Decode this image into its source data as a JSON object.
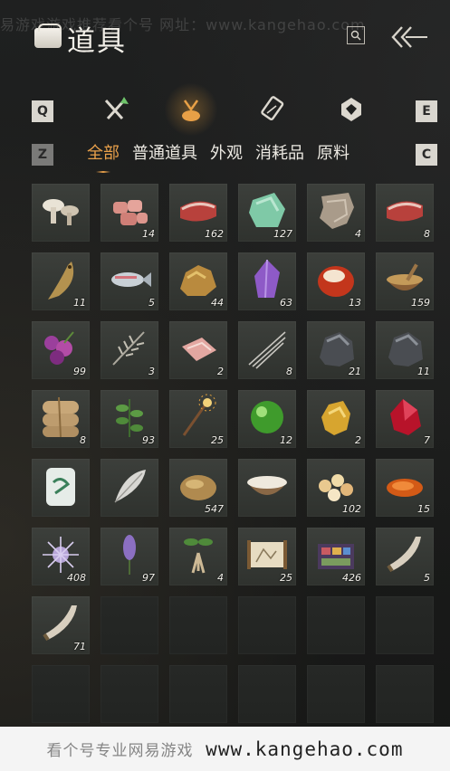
{
  "watermark_top": "易游戏游戏推荐看个号   网址：www.kangehao.com",
  "header": {
    "title": "道具",
    "search_icon": "search-icon",
    "back_icon": "back-arrow-icon"
  },
  "key_hints": {
    "prev_tab": "Q",
    "next_tab": "E",
    "prev_filter": "Z",
    "next_filter": "C"
  },
  "category_tabs": [
    {
      "name": "tools-tab",
      "icon": "crossed-tools-icon",
      "active": false
    },
    {
      "name": "items-tab",
      "icon": "pouch-icon",
      "active": true
    },
    {
      "name": "scrolls-tab",
      "icon": "scroll-icon",
      "active": false
    },
    {
      "name": "gems-tab",
      "icon": "gem-badge-icon",
      "active": false
    }
  ],
  "filters": [
    {
      "label": "全部",
      "active": true
    },
    {
      "label": "普通道具",
      "active": false
    },
    {
      "label": "外观",
      "active": false
    },
    {
      "label": "消耗品",
      "active": false
    },
    {
      "label": "原料",
      "active": false
    }
  ],
  "items": [
    {
      "icon": "mushrooms-icon",
      "qty": ""
    },
    {
      "icon": "meat-chunks-icon",
      "qty": "14"
    },
    {
      "icon": "steak-icon",
      "qty": "162"
    },
    {
      "icon": "jade-stone-icon",
      "qty": "127"
    },
    {
      "icon": "animal-hide-icon",
      "qty": "4"
    },
    {
      "icon": "steak-icon",
      "qty": "8"
    },
    {
      "icon": "fish-dried-icon",
      "qty": "11"
    },
    {
      "icon": "fish-icon",
      "qty": "5"
    },
    {
      "icon": "gold-ore-icon",
      "qty": "44"
    },
    {
      "icon": "amethyst-icon",
      "qty": "63"
    },
    {
      "icon": "red-agate-icon",
      "qty": "13"
    },
    {
      "icon": "grain-bowl-icon",
      "qty": "159"
    },
    {
      "icon": "purple-flower-icon",
      "qty": "99"
    },
    {
      "icon": "wheat-icon",
      "qty": "3"
    },
    {
      "icon": "raw-meat-slice-icon",
      "qty": "2"
    },
    {
      "icon": "quills-icon",
      "qty": "8"
    },
    {
      "icon": "iron-ore-icon",
      "qty": "21"
    },
    {
      "icon": "iron-ore-icon",
      "qty": "11"
    },
    {
      "icon": "grain-sacks-icon",
      "qty": "8"
    },
    {
      "icon": "herb-plant-icon",
      "qty": "93"
    },
    {
      "icon": "firework-stick-icon",
      "qty": "25"
    },
    {
      "icon": "green-orb-icon",
      "qty": "12"
    },
    {
      "icon": "gold-nugget-icon",
      "qty": "2"
    },
    {
      "icon": "red-crystal-icon",
      "qty": "7"
    },
    {
      "icon": "porcelain-vase-icon",
      "qty": ""
    },
    {
      "icon": "feather-icon",
      "qty": ""
    },
    {
      "icon": "seed-pod-icon",
      "qty": "547"
    },
    {
      "icon": "milk-bowl-icon",
      "qty": ""
    },
    {
      "icon": "pastries-icon",
      "qty": "102"
    },
    {
      "icon": "orange-paste-icon",
      "qty": "15"
    },
    {
      "icon": "spiky-flower-icon",
      "qty": "408"
    },
    {
      "icon": "lavender-icon",
      "qty": "97"
    },
    {
      "icon": "ginseng-icon",
      "qty": "4"
    },
    {
      "icon": "painting-scroll-icon",
      "qty": "25"
    },
    {
      "icon": "paint-box-icon",
      "qty": "426"
    },
    {
      "icon": "horn-icon",
      "qty": "5"
    },
    {
      "icon": "horn-icon",
      "qty": "71"
    },
    {
      "icon": "",
      "qty": ""
    },
    {
      "icon": "",
      "qty": ""
    },
    {
      "icon": "",
      "qty": ""
    },
    {
      "icon": "",
      "qty": ""
    },
    {
      "icon": "",
      "qty": ""
    },
    {
      "icon": "",
      "qty": ""
    },
    {
      "icon": "",
      "qty": ""
    },
    {
      "icon": "",
      "qty": ""
    },
    {
      "icon": "",
      "qty": ""
    },
    {
      "icon": "",
      "qty": ""
    },
    {
      "icon": "",
      "qty": ""
    }
  ],
  "bottom_watermark": {
    "prefix": "看个号专业网易游戏",
    "url": "www.kangehao.com"
  },
  "colors": {
    "accent": "#e9a04a",
    "cell": "#363935",
    "bg": "#1b1c1b"
  }
}
